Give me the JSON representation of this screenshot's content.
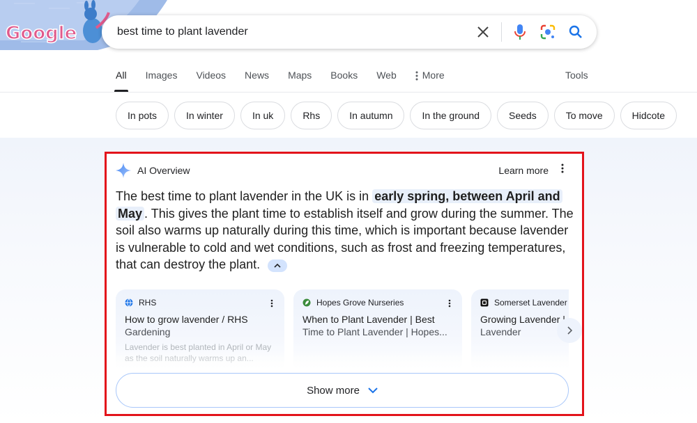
{
  "search": {
    "query": "best time to plant lavender"
  },
  "tabs": [
    {
      "label": "All"
    },
    {
      "label": "Images"
    },
    {
      "label": "Videos"
    },
    {
      "label": "News"
    },
    {
      "label": "Maps"
    },
    {
      "label": "Books"
    },
    {
      "label": "Web"
    },
    {
      "label": "More"
    }
  ],
  "tools_label": "Tools",
  "chips": [
    "In pots",
    "In winter",
    "In uk",
    "Rhs",
    "In autumn",
    "In the ground",
    "Seeds",
    "To move",
    "Hidcote"
  ],
  "ai_overview": {
    "title": "AI Overview",
    "learn_more": "Learn more",
    "text_before": "The best time to plant lavender in the UK is in ",
    "highlight_1": "early spring, between April and",
    "highlight_2": "May",
    "text_after": ". This gives the plant time to establish itself and grow during the summer. The soil also warms up naturally during this time, which is important because lavender is vulnerable to cold and wet conditions, such as frost and freezing temperatures, that can destroy the plant.",
    "sources": [
      {
        "site": "RHS",
        "title": "How to grow lavender / RHS",
        "title_cont": "Gardening",
        "snippet": "Lavender is best planted in April or May as the soil naturally warms up an..."
      },
      {
        "site": "Hopes Grove Nurseries",
        "title": "When to Plant Lavender | Best",
        "title_cont": "Time to Plant Lavender | Hopes...",
        "snippet": ""
      },
      {
        "site": "Somerset Lavender",
        "title": "Growing Lavender |",
        "title_cont": "Lavender",
        "snippet": ""
      }
    ],
    "show_more": "Show more"
  },
  "doodle_text": "Google",
  "colors": {
    "accent": "#1a73e8",
    "highlight_box": "#e3131b"
  }
}
